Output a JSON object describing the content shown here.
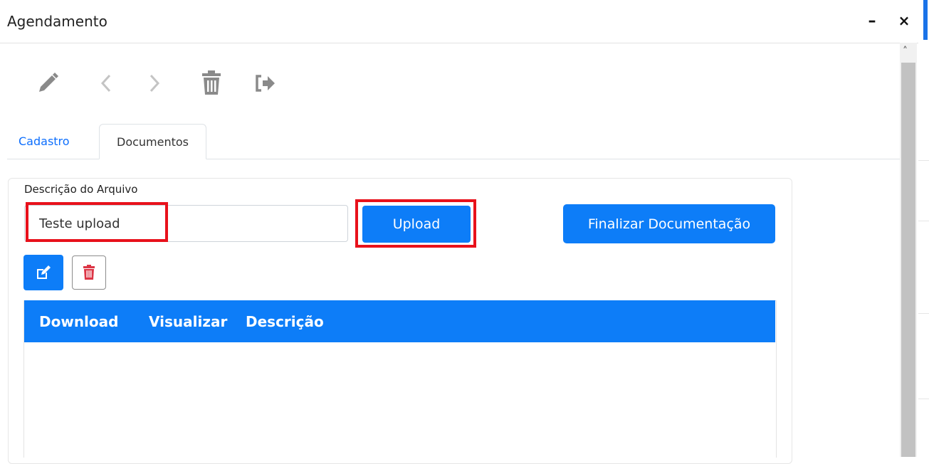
{
  "window": {
    "title": "Agendamento",
    "minimize_label": "–",
    "close_label": "×"
  },
  "toolbar": {
    "icons": [
      "pencil-icon",
      "chevron-left-icon",
      "chevron-right-icon",
      "trash-icon",
      "sign-out-icon"
    ]
  },
  "tabs": [
    {
      "label": "Cadastro",
      "active": false
    },
    {
      "label": "Documentos",
      "active": true
    }
  ],
  "form": {
    "description_label": "Descrição do Arquivo",
    "description_value": "Teste upload",
    "upload_label": "Upload",
    "finalize_label": "Finalizar Documentação"
  },
  "table": {
    "columns": [
      "Download",
      "Visualizar",
      "Descrição"
    ],
    "rows": []
  },
  "colors": {
    "primary": "#0d7df8",
    "highlight": "#e8111b",
    "danger": "#dc3545",
    "icon_gray": "#8a8a8a"
  }
}
